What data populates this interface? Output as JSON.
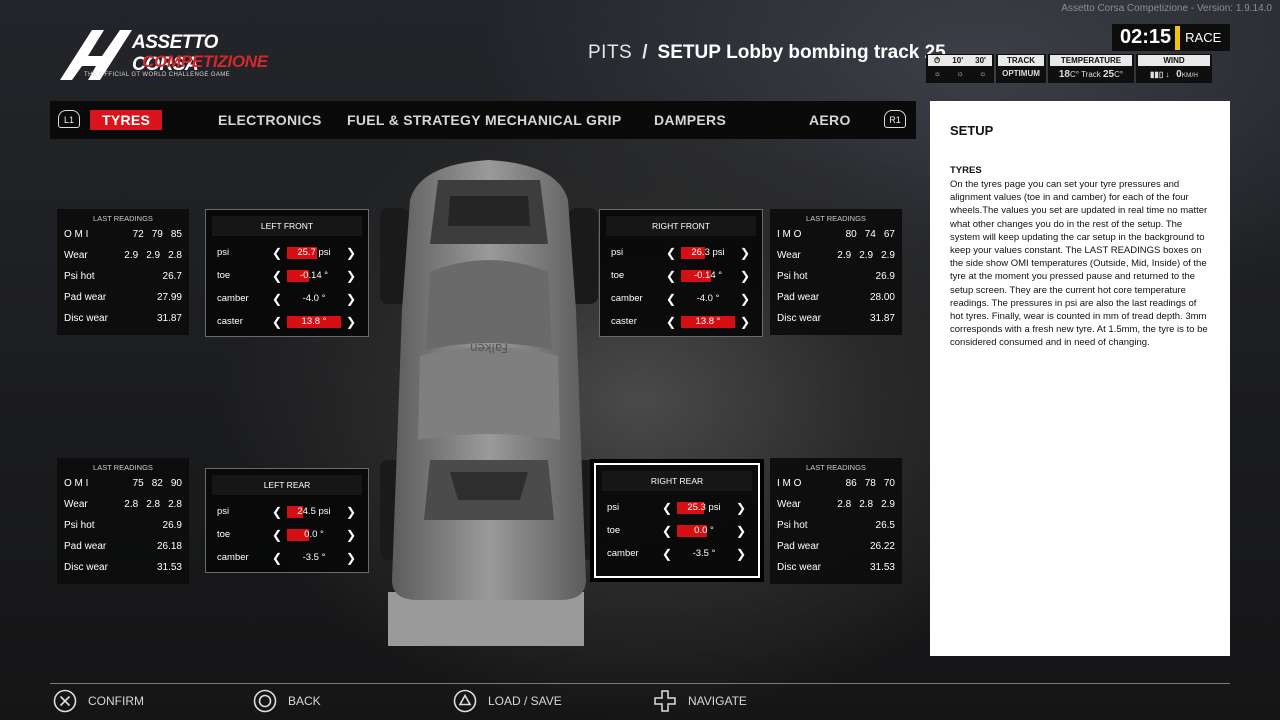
{
  "version": "Assetto Corsa Competizione - Version: 1.9.14.0",
  "logo": {
    "line1": "ASSETTO CORSA",
    "line2": "COMPETIZIONE",
    "tagline": "THE OFFICIAL GT WORLD CHALLENGE GAME"
  },
  "header": {
    "section": "PITS",
    "separator": "/",
    "setup_label": "SETUP",
    "setup_name": "Lobby bombing track 25"
  },
  "session": {
    "time": "02:15",
    "type": "RACE"
  },
  "conditions": {
    "time_marks": [
      "10'",
      "30'"
    ],
    "track_label": "TRACK",
    "track_value": "OPTIMUM",
    "temp_label": "TEMPERATURE",
    "air_temp": "18",
    "track_temp_label": "Track",
    "track_temp": "25",
    "temp_unit": "C°",
    "wind_label": "WIND",
    "wind_speed": "0",
    "wind_unit": "KM/H"
  },
  "tabs": {
    "l1": "L1",
    "r1": "R1",
    "items": [
      "TYRES",
      "ELECTRONICS",
      "FUEL & STRATEGY",
      "MECHANICAL GRIP",
      "DAMPERS",
      "AERO"
    ]
  },
  "info": {
    "title": "SETUP",
    "subtitle": "TYRES",
    "body": "On the tyres page you can set your tyre pressures and alignment values (toe in and camber) for each of the four wheels.The values you set are updated in real time no matter what other changes you do in the rest of the setup. The system will keep updating the car setup in the background to keep your values constant. The LAST READINGS boxes on the side show OMI temperatures (Outside, Mid, Inside) of the tyre at the moment you pressed pause and returned to the setup screen. They are the current hot core temperature readings. The pressures in psi are also the last readings of hot tyres. Finally, wear is counted in mm of tread depth. 3mm corresponds with a fresh new tyre. At 1.5mm, the tyre is to be considered consumed and in need of changing."
  },
  "readings": {
    "title": "LAST READINGS",
    "wear_label": "Wear",
    "psi_hot_label": "Psi hot",
    "pad_wear_label": "Pad wear",
    "disc_wear_label": "Disc wear",
    "lf": {
      "temps_label": "O M I",
      "temps": [
        "72",
        "79",
        "85"
      ],
      "wear": [
        "2.9",
        "2.9",
        "2.8"
      ],
      "psi_hot": "26.7",
      "pad_wear": "27.99",
      "disc_wear": "31.87"
    },
    "rf": {
      "temps_label": "I M O",
      "temps": [
        "80",
        "74",
        "67"
      ],
      "wear": [
        "2.9",
        "2.9",
        "2.9"
      ],
      "psi_hot": "26.9",
      "pad_wear": "28.00",
      "disc_wear": "31.87"
    },
    "lr": {
      "temps_label": "O M I",
      "temps": [
        "75",
        "82",
        "90"
      ],
      "wear": [
        "2.8",
        "2.8",
        "2.8"
      ],
      "psi_hot": "26.9",
      "pad_wear": "26.18",
      "disc_wear": "31.53"
    },
    "rr": {
      "temps_label": "I M O",
      "temps": [
        "86",
        "78",
        "70"
      ],
      "wear": [
        "2.8",
        "2.8",
        "2.9"
      ],
      "psi_hot": "26.5",
      "pad_wear": "26.22",
      "disc_wear": "31.53"
    }
  },
  "wheels": {
    "lf": {
      "title": "LEFT FRONT",
      "params": [
        {
          "label": "psi",
          "value": "25.7 psi",
          "fill": 0.55
        },
        {
          "label": "toe",
          "value": "-0.14 °",
          "fill": 0.4
        },
        {
          "label": "camber",
          "value": "-4.0 °",
          "fill": 0.0
        },
        {
          "label": "caster",
          "value": "13.8 °",
          "fill": 1.0
        }
      ]
    },
    "rf": {
      "title": "RIGHT FRONT",
      "params": [
        {
          "label": "psi",
          "value": "26.3 psi",
          "fill": 0.45
        },
        {
          "label": "toe",
          "value": "-0.14 °",
          "fill": 0.55
        },
        {
          "label": "camber",
          "value": "-4.0 °",
          "fill": 0.0
        },
        {
          "label": "caster",
          "value": "13.8 °",
          "fill": 1.0
        }
      ]
    },
    "lr": {
      "title": "LEFT REAR",
      "params": [
        {
          "label": "psi",
          "value": "24.5 psi",
          "fill": 0.3
        },
        {
          "label": "toe",
          "value": "0.0 °",
          "fill": 0.4
        },
        {
          "label": "camber",
          "value": "-3.5 °",
          "fill": 0.0
        }
      ]
    },
    "rr": {
      "title": "RIGHT REAR",
      "params": [
        {
          "label": "psi",
          "value": "25.3 psi",
          "fill": 0.5
        },
        {
          "label": "toe",
          "value": "0.0 °",
          "fill": 0.55
        },
        {
          "label": "camber",
          "value": "-3.5 °",
          "fill": 0.0
        }
      ]
    }
  },
  "footer": {
    "confirm": "CONFIRM",
    "back": "BACK",
    "load_save": "LOAD / SAVE",
    "navigate": "NAVIGATE"
  },
  "colors": {
    "accent": "#d9151b",
    "timer_bar": "#f5c400"
  }
}
